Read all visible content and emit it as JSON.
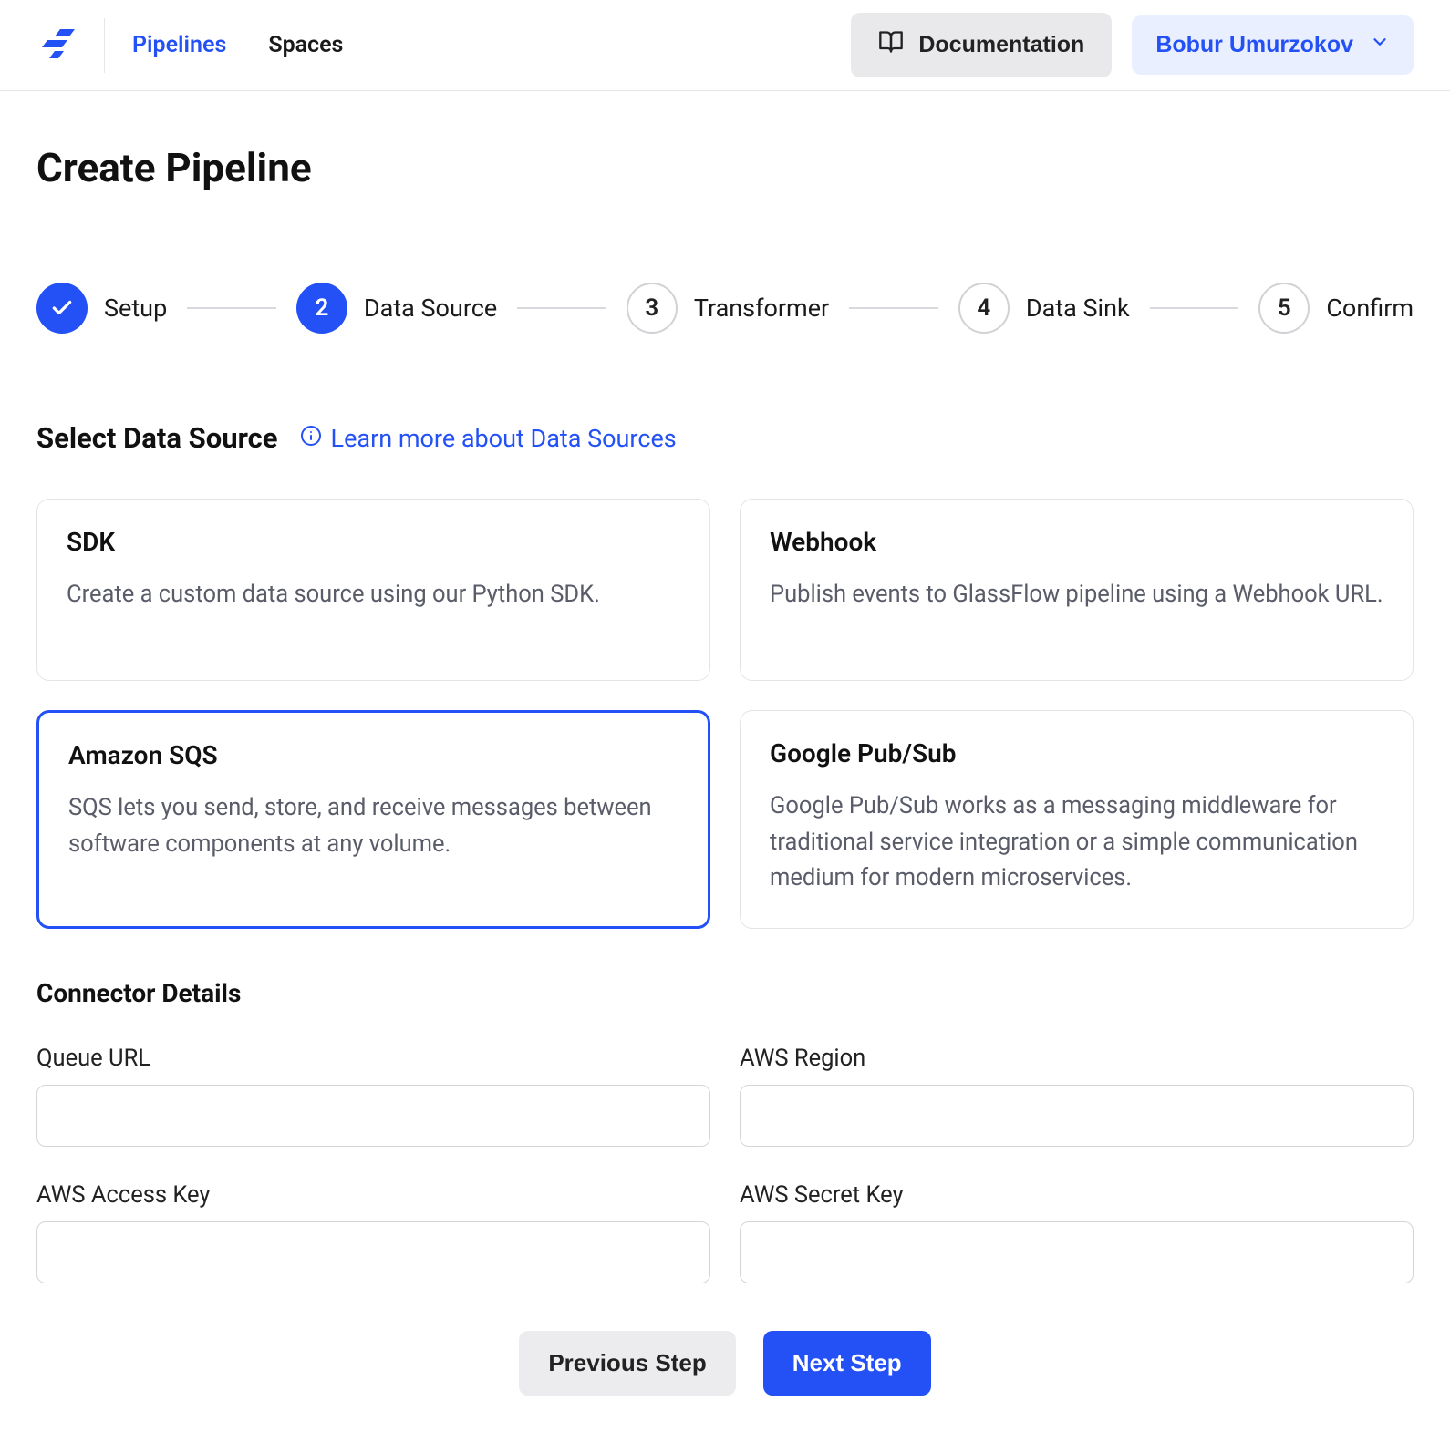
{
  "header": {
    "nav": {
      "pipelines": "Pipelines",
      "spaces": "Spaces"
    },
    "documentation_label": "Documentation",
    "user_name": "Bobur Umurzokov"
  },
  "page_title": "Create Pipeline",
  "stepper": [
    {
      "num": "1",
      "label": "Setup",
      "state": "done"
    },
    {
      "num": "2",
      "label": "Data Source",
      "state": "current"
    },
    {
      "num": "3",
      "label": "Transformer",
      "state": "upcoming"
    },
    {
      "num": "4",
      "label": "Data Sink",
      "state": "upcoming"
    },
    {
      "num": "5",
      "label": "Confirm",
      "state": "upcoming"
    }
  ],
  "section": {
    "title": "Select Data Source",
    "learn_more": "Learn more about Data Sources"
  },
  "sources": [
    {
      "title": "SDK",
      "desc": "Create a custom data source using our Python SDK.",
      "selected": false
    },
    {
      "title": "Webhook",
      "desc": "Publish events to GlassFlow pipeline using a Webhook URL.",
      "selected": false
    },
    {
      "title": "Amazon SQS",
      "desc": "SQS lets you send, store, and receive messages between software components at any volume.",
      "selected": true
    },
    {
      "title": "Google Pub/Sub",
      "desc": "Google Pub/Sub works as a messaging middleware for traditional service integration or a simple communication medium for modern microservices.",
      "selected": false
    }
  ],
  "connector": {
    "title": "Connector Details",
    "fields": {
      "queue_url": {
        "label": "Queue URL",
        "value": ""
      },
      "aws_region": {
        "label": "AWS Region",
        "value": ""
      },
      "aws_access_key": {
        "label": "AWS Access Key",
        "value": ""
      },
      "aws_secret_key": {
        "label": "AWS Secret Key",
        "value": ""
      }
    }
  },
  "buttons": {
    "previous": "Previous Step",
    "next": "Next Step"
  }
}
